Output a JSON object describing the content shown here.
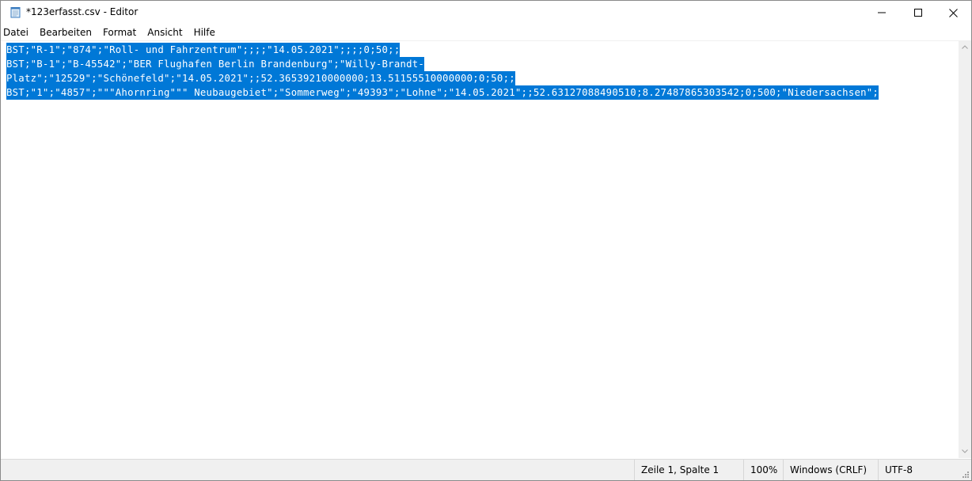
{
  "window": {
    "title": "*123erfasst.csv - Editor",
    "icon": "notepad-icon"
  },
  "caption_buttons": {
    "minimize_icon": "minimize-icon",
    "maximize_icon": "maximize-icon",
    "close_icon": "close-icon"
  },
  "menu": {
    "items": [
      "Datei",
      "Bearbeiten",
      "Format",
      "Ansicht",
      "Hilfe"
    ]
  },
  "editor": {
    "lines": [
      "BST;\"R-1\";\"874\";\"Roll- und Fahrzentrum\";;;;\"14.05.2021\";;;;0;50;;",
      "BST;\"B-1\";\"B-45542\";\"BER Flughafen Berlin Brandenburg\";\"Willy-Brandt-",
      "Platz\";\"12529\";\"Schönefeld\";\"14.05.2021\";;52.36539210000000;13.51155510000000;0;50;;",
      "BST;\"1\";\"4857\";\"\"\"Ahornring\"\"\" Neubaugebiet\";\"Sommerweg\";\"49393\";\"Lohne\";\"14.05.2021\";;52.63127088490510;8.27487865303542;0;500;\"Niedersachsen\";"
    ],
    "selection_color": "#0078d7"
  },
  "statusbar": {
    "position": "Zeile 1, Spalte 1",
    "zoom": "100%",
    "line_ending": "Windows (CRLF)",
    "encoding": "UTF-8"
  }
}
